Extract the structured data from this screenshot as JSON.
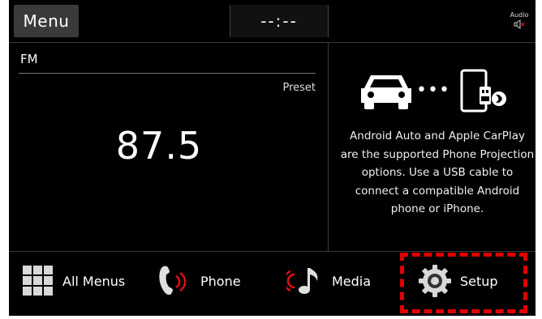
{
  "header": {
    "menu_label": "Menu",
    "clock": "--:--",
    "audio_label": "Audio"
  },
  "radio": {
    "band": "FM",
    "preset_label": "Preset",
    "frequency": "87.5"
  },
  "info": {
    "dots": "•••",
    "text": "Android Auto and Apple CarPlay are the supported Phone Projection options. Use a USB cable to connect a compatible Android phone or iPhone."
  },
  "nav": {
    "items": [
      {
        "label": "All Menus",
        "icon": "grid-icon"
      },
      {
        "label": "Phone",
        "icon": "phone-icon"
      },
      {
        "label": "Media",
        "icon": "music-note-icon"
      },
      {
        "label": "Setup",
        "icon": "gear-icon"
      }
    ]
  },
  "colors": {
    "highlight": "#e00000",
    "accent_red": "#e01010",
    "background": "#000000"
  }
}
